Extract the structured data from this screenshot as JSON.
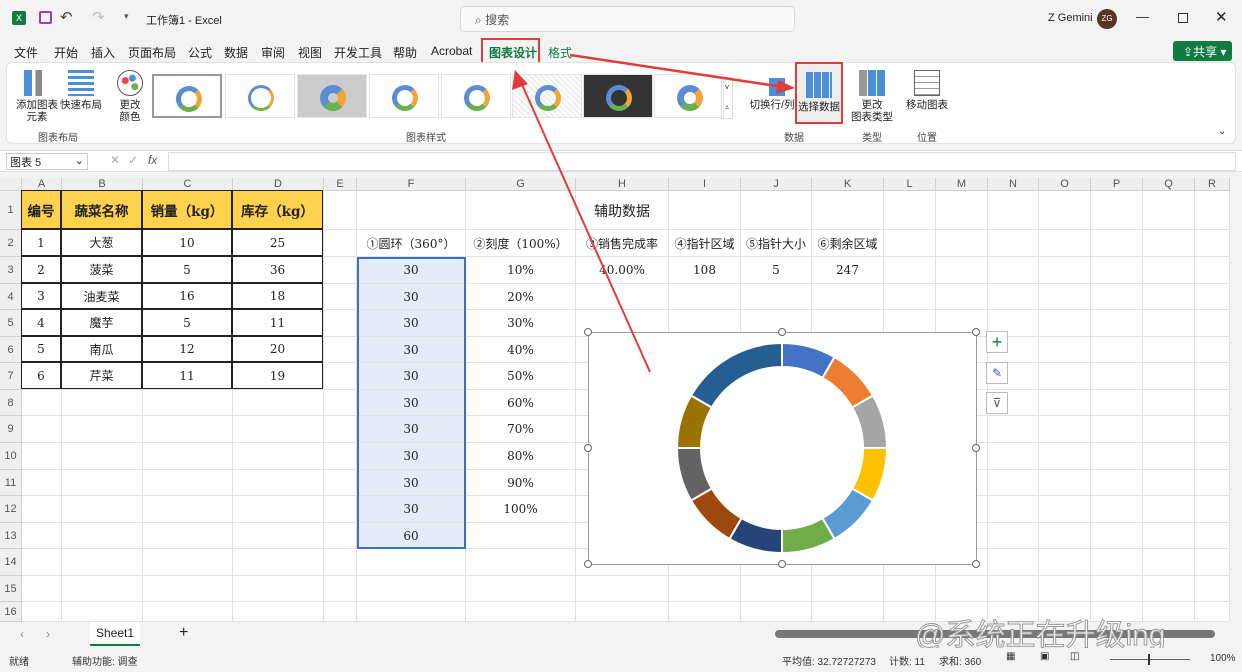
{
  "titlebar": {
    "title": "工作簿1 - Excel",
    "search_placeholder": "搜索",
    "user": "Z Gemini",
    "avatar": "ZG"
  },
  "menu": [
    "文件",
    "开始",
    "插入",
    "页面布局",
    "公式",
    "数据",
    "审阅",
    "视图",
    "开发工具",
    "帮助",
    "Acrobat",
    "图表设计",
    "格式"
  ],
  "share_label": "共享",
  "ribbon": {
    "add_element": "添加图表\n元素",
    "quick_layout": "快速布局",
    "change_colors": "更改\n颜色",
    "group_layout": "图表布局",
    "group_styles": "图表样式",
    "switch_row_col": "切换行/列",
    "select_data": "选择数据",
    "change_type": "更改\n图表类型",
    "move_chart": "移动图表",
    "group_data": "数据",
    "group_type": "类型",
    "group_location": "位置"
  },
  "formula_bar": {
    "name_box": "图表 5",
    "fx": "fx",
    "value": ""
  },
  "columns": [
    "A",
    "B",
    "C",
    "D",
    "E",
    "F",
    "G",
    "H",
    "I",
    "J",
    "K",
    "L",
    "M",
    "N",
    "O",
    "P",
    "Q",
    "R"
  ],
  "rows": [
    "1",
    "2",
    "3",
    "4",
    "5",
    "6",
    "7",
    "8",
    "9",
    "10",
    "11",
    "12",
    "13",
    "14",
    "15",
    "16"
  ],
  "table1": {
    "headers": [
      "编号",
      "蔬菜名称",
      "销量（kg）",
      "库存（kg）"
    ],
    "rows": [
      [
        "1",
        "大葱",
        "10",
        "25"
      ],
      [
        "2",
        "菠菜",
        "5",
        "36"
      ],
      [
        "3",
        "油麦菜",
        "16",
        "18"
      ],
      [
        "4",
        "魔芋",
        "5",
        "11"
      ],
      [
        "5",
        "南瓜",
        "12",
        "20"
      ],
      [
        "6",
        "芹菜",
        "11",
        "19"
      ]
    ]
  },
  "aux": {
    "title": "辅助数据",
    "headers": [
      "①圆环（360°）",
      "②刻度（100%）",
      "③销售完成率",
      "④指针区域",
      "⑤指针大小",
      "⑥剩余区域"
    ],
    "row3_rest": [
      "40.00%",
      "108",
      "5",
      "247"
    ],
    "ring": [
      "30",
      "30",
      "30",
      "30",
      "30",
      "30",
      "30",
      "30",
      "30",
      "30",
      "60"
    ],
    "scale": [
      "10%",
      "20%",
      "30%",
      "40%",
      "50%",
      "60%",
      "70%",
      "80%",
      "90%",
      "100%"
    ]
  },
  "chart_data": {
    "type": "pie",
    "variant": "doughnut",
    "values": [
      30,
      30,
      30,
      30,
      30,
      30,
      30,
      30,
      30,
      30,
      60
    ],
    "colors": [
      "#4472C4",
      "#ED7D31",
      "#A5A5A5",
      "#FFC000",
      "#5B9BD5",
      "#70AD47",
      "#264478",
      "#9E480E",
      "#636363",
      "#997300",
      "#255E91"
    ]
  },
  "sheet_tab": "Sheet1",
  "status": {
    "ready": "就绪",
    "accessibility": "辅助功能: 调查",
    "average": "平均值: 32.72727273",
    "count": "计数: 11",
    "sum": "求和: 360",
    "zoom": "100%"
  },
  "watermark": "@系统正在升级ing",
  "accent": "#107c41"
}
